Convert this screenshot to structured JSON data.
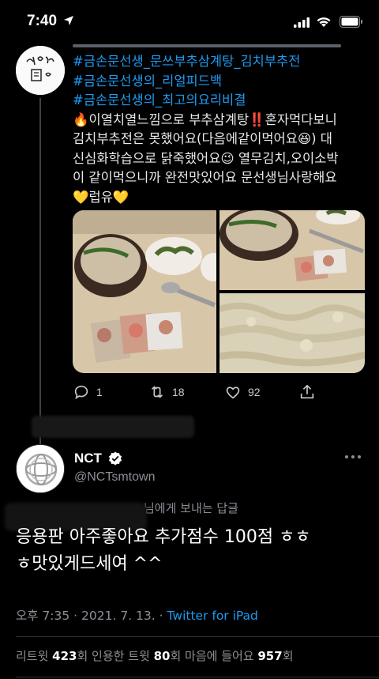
{
  "status_bar": {
    "time": "7:40"
  },
  "parent_tweet": {
    "hashtags": [
      "#금손문선생_문쓰부추삼계탕_김치부추전",
      "#금손문선생의_리얼피드백",
      "#금손문선생의_최고의요리비결"
    ],
    "body_lines": [
      "🔥이열치열느낌으로 부추삼계탕‼️혼자먹다보니",
      "김치부추전은 못했어요(다음에같이먹어요😆) 대",
      "신심화학습으로 닭죽했어요😉 열무김치,오이소박",
      "이 같이먹으니까 완전맛있어요 문선생님사랑해요",
      "💛럽유💛"
    ],
    "actions": {
      "replies": "1",
      "retweets": "18",
      "likes": "92"
    }
  },
  "main_tweet": {
    "author_name": "NCT",
    "author_handle": "@NCTsmtown",
    "reply_to_suffix": "님에게 보내는 답글",
    "text_lines": [
      "응용판 아주좋아요 추가점수 100점 ㅎㅎ",
      "ㅎ맛있게드세여 ^^"
    ],
    "timestamp": "오후 7:35 · 2021. 7. 13. · ",
    "source": "Twitter for iPad",
    "stats": {
      "retweet_label": "리트윗 ",
      "retweet_count": "423",
      "retweet_unit": "회  인용한 트윗 ",
      "quote_count": "80",
      "quote_unit": "회  마음에 들어요 ",
      "like_count": "957",
      "like_unit": "회"
    }
  },
  "colors": {
    "background": "#000000",
    "link": "#1d9bf0",
    "secondary_text": "#8b9096",
    "divider": "#2f3336"
  },
  "icons": [
    "location-arrow-icon",
    "signal-icon",
    "wifi-icon",
    "battery-icon",
    "reply-icon",
    "retweet-icon",
    "like-icon",
    "share-icon",
    "verified-icon",
    "more-icon"
  ]
}
